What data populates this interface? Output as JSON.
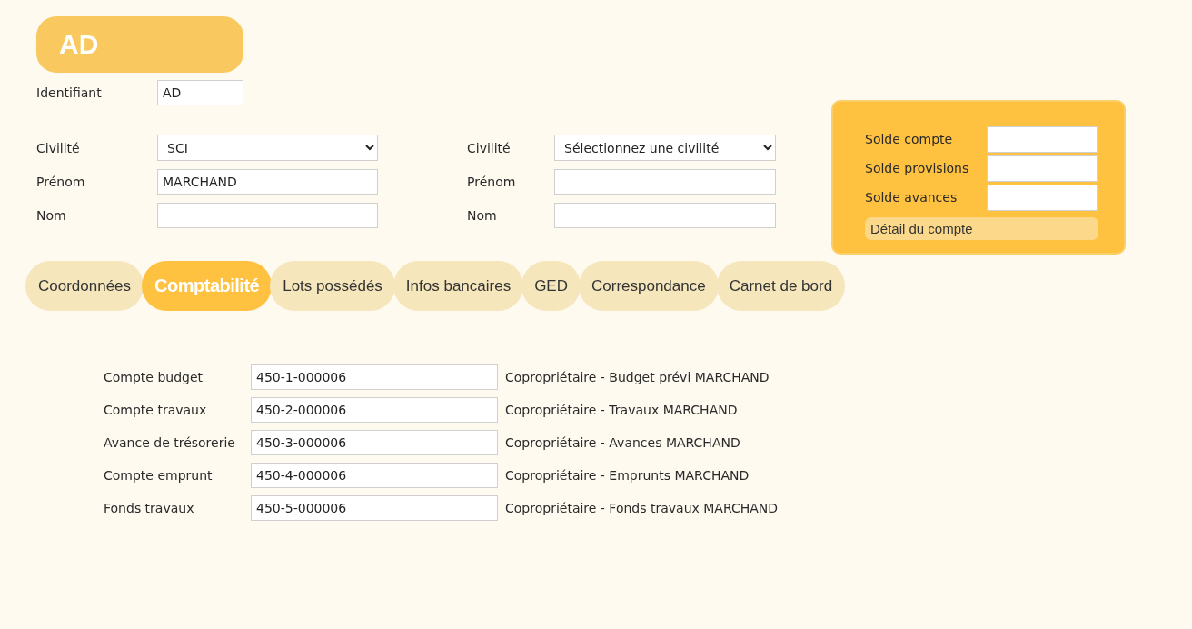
{
  "header": {
    "title": "AD"
  },
  "identifier": {
    "label": "Identifiant",
    "value": "AD"
  },
  "person_columns": [
    {
      "fields": [
        {
          "kind": "select",
          "label": "Civilité",
          "value": "SCI"
        },
        {
          "kind": "text",
          "label": "Prénom",
          "value": "MARCHAND"
        },
        {
          "kind": "text",
          "label": "Nom"
        }
      ]
    },
    {
      "fields": [
        {
          "kind": "select",
          "label": "Civilité",
          "value": "Sélectionnez une civilité"
        },
        {
          "kind": "text",
          "label": "Prénom"
        },
        {
          "kind": "text",
          "label": "Nom"
        }
      ]
    }
  ],
  "balance_panel": {
    "rows": [
      {
        "label": "Solde compte"
      },
      {
        "label": "Solde provisions"
      },
      {
        "label": "Solde avances"
      }
    ],
    "button": "Détail du compte"
  },
  "tabs": [
    {
      "label": "Coordonnées",
      "selected": false
    },
    {
      "label": "Comptabilité",
      "selected": true
    },
    {
      "label": "Lots possédés",
      "selected": false
    },
    {
      "label": "Infos bancaires",
      "selected": false
    },
    {
      "label": "GED",
      "selected": false
    },
    {
      "label": "Correspondance",
      "selected": false
    },
    {
      "label": "Carnet de bord",
      "selected": false
    }
  ],
  "accounts": [
    {
      "label": "Compte budget",
      "value": "450-1-000006",
      "description": "Copropriétaire - Budget prévi MARCHAND"
    },
    {
      "label": "Compte travaux",
      "value": "450-2-000006",
      "description": "Copropriétaire - Travaux MARCHAND"
    },
    {
      "label": "Avance de trésorerie",
      "value": "450-3-000006",
      "description": "Copropriétaire - Avances MARCHAND"
    },
    {
      "label": "Compte emprunt",
      "value": "450-4-000006",
      "description": "Copropriétaire - Emprunts MARCHAND"
    },
    {
      "label": "Fonds travaux",
      "value": "450-5-000006",
      "description": "Copropriétaire - Fonds travaux MARCHAND"
    }
  ]
}
